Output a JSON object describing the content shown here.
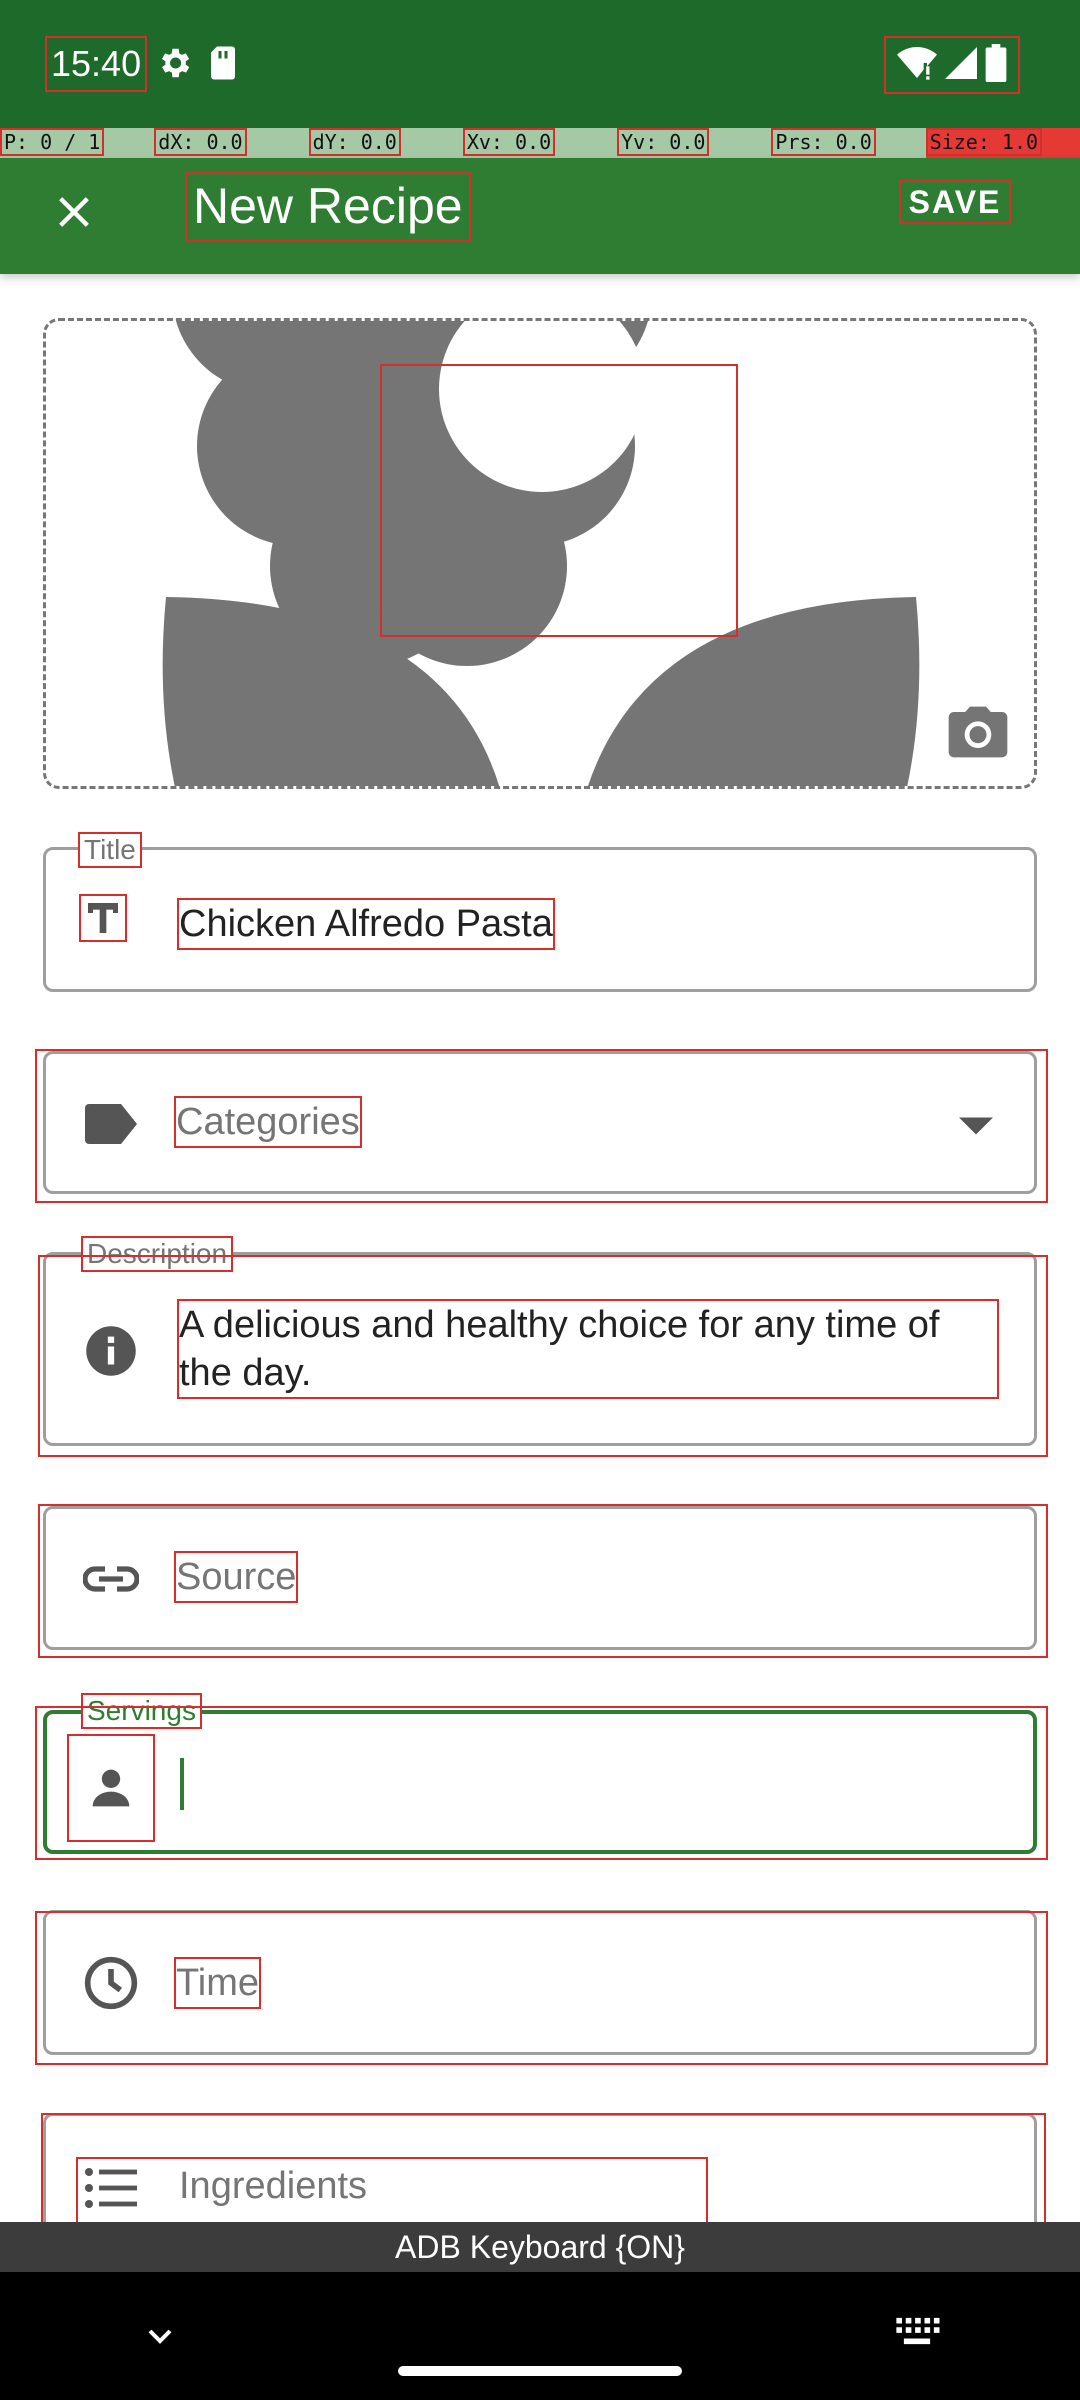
{
  "status_bar": {
    "time": "15:40",
    "icons": [
      "settings-icon",
      "sd-card-icon",
      "wifi-alert-icon",
      "signal-icon",
      "battery-icon"
    ]
  },
  "debug_strip": {
    "pointer": "P: 0 / 1",
    "dx": "dX: 0.0",
    "dy": "dY: 0.0",
    "xv": "Xv: 0.0",
    "yv": "Yv: 0.0",
    "prs": "Prs: 0.0",
    "size": "Size: 1.0"
  },
  "app_bar": {
    "title": "New Recipe",
    "save_label": "SAVE",
    "close_icon": "close-icon"
  },
  "image_picker": {
    "placeholder_icon": "flower-icon",
    "camera_icon": "camera-icon"
  },
  "form": {
    "title": {
      "label": "Title",
      "value": "Chicken Alfredo Pasta",
      "icon": "title-icon"
    },
    "categories": {
      "placeholder": "Categories",
      "icon": "tag-icon",
      "dropdown_icon": "dropdown-arrow-icon"
    },
    "description": {
      "label": "Description",
      "value": "A delicious and healthy choice for any time of the day.",
      "icon": "info-icon"
    },
    "source": {
      "placeholder": "Source",
      "icon": "link-icon"
    },
    "servings": {
      "label": "Servings",
      "value": "",
      "icon": "person-icon"
    },
    "time": {
      "placeholder": "Time",
      "icon": "clock-icon"
    },
    "ingredients": {
      "placeholder": "Ingredients",
      "icon": "list-icon"
    }
  },
  "keyboard": {
    "status": "ADB Keyboard {ON}"
  },
  "nav_bar": {
    "back_icon": "chevron-down-icon",
    "keyboard_icon": "keyboard-icon"
  },
  "colors": {
    "status_bar": "#1e6a2a",
    "app_bar": "#2e7d32",
    "focus": "#2e7d32",
    "debug_strip": "#a5c9a5"
  }
}
